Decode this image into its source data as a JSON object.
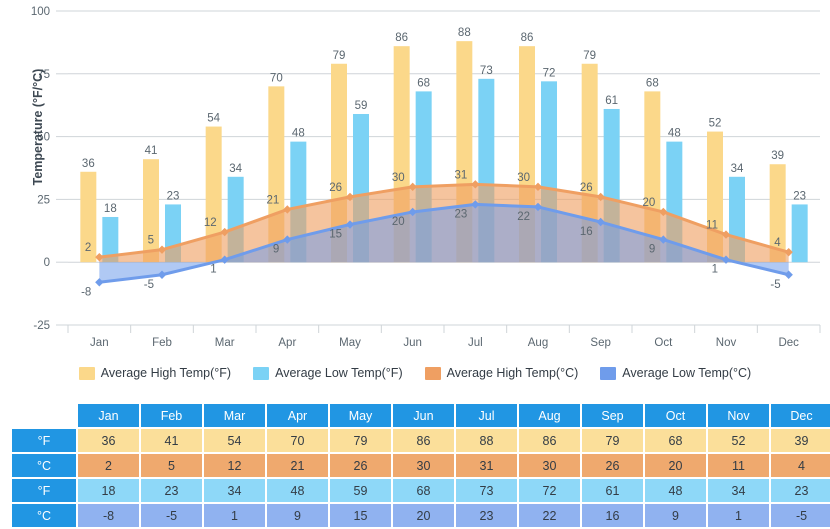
{
  "chart_data": {
    "type": "bar",
    "title": "",
    "xlabel": "",
    "ylabel": "Temperature (°F/°C)",
    "ylim": [
      -25,
      100
    ],
    "yticks": [
      100,
      75,
      50,
      25,
      0,
      -25
    ],
    "grid": true,
    "legend_position": "bottom",
    "categories": [
      "Jan",
      "Feb",
      "Mar",
      "Apr",
      "May",
      "Jun",
      "Jul",
      "Aug",
      "Sep",
      "Oct",
      "Nov",
      "Dec"
    ],
    "series": [
      {
        "name": "Average High Temp(°F)",
        "type": "bar",
        "color": "#fbd88a",
        "values": [
          36,
          41,
          54,
          70,
          79,
          86,
          88,
          86,
          79,
          68,
          52,
          39
        ]
      },
      {
        "name": "Average Low Temp(°F)",
        "type": "bar",
        "color": "#7bd2f5",
        "values": [
          18,
          23,
          34,
          48,
          59,
          68,
          73,
          72,
          61,
          48,
          34,
          23
        ]
      },
      {
        "name": "Average High Temp(°C)",
        "type": "area",
        "color": "#ef9f62",
        "values": [
          2,
          5,
          12,
          21,
          26,
          30,
          31,
          30,
          26,
          20,
          11,
          4
        ]
      },
      {
        "name": "Average Low Temp(°C)",
        "type": "area",
        "color": "#6f9ceb",
        "values": [
          -8,
          -5,
          1,
          9,
          15,
          20,
          23,
          22,
          16,
          9,
          1,
          -5
        ]
      }
    ]
  },
  "legend": {
    "items": [
      {
        "label": "Average High Temp(°F)",
        "color": "#fbd88a"
      },
      {
        "label": "Average Low Temp(°F)",
        "color": "#7bd2f5"
      },
      {
        "label": "Average High Temp(°C)",
        "color": "#ef9f62"
      },
      {
        "label": "Average Low Temp(°C)",
        "color": "#6f9ceb"
      }
    ]
  },
  "table": {
    "corner_label": "",
    "months": [
      "Jan",
      "Feb",
      "Mar",
      "Apr",
      "May",
      "Jun",
      "Jul",
      "Aug",
      "Sep",
      "Oct",
      "Nov",
      "Dec"
    ],
    "rows": [
      {
        "unit": "°F",
        "style": "v-hf",
        "values": [
          "36",
          "41",
          "54",
          "70",
          "79",
          "86",
          "88",
          "86",
          "79",
          "68",
          "52",
          "39"
        ]
      },
      {
        "unit": "°C",
        "style": "v-hc",
        "values": [
          "2",
          "5",
          "12",
          "21",
          "26",
          "30",
          "31",
          "30",
          "26",
          "20",
          "11",
          "4"
        ]
      },
      {
        "unit": "°F",
        "style": "v-lf",
        "values": [
          "18",
          "23",
          "34",
          "48",
          "59",
          "68",
          "73",
          "72",
          "61",
          "48",
          "34",
          "23"
        ]
      },
      {
        "unit": "°C",
        "style": "v-lc",
        "values": [
          "-8",
          "-5",
          "1",
          "9",
          "15",
          "20",
          "23",
          "22",
          "16",
          "9",
          "1",
          "-5"
        ]
      }
    ]
  },
  "colors": {
    "high_f": "#fbd88a",
    "low_f": "#7bd2f5",
    "high_c": "#ef9f62",
    "low_c": "#6f9ceb",
    "table_header": "#2196e3",
    "grid": "#cfd4d8",
    "axis_text": "#5b6770"
  }
}
